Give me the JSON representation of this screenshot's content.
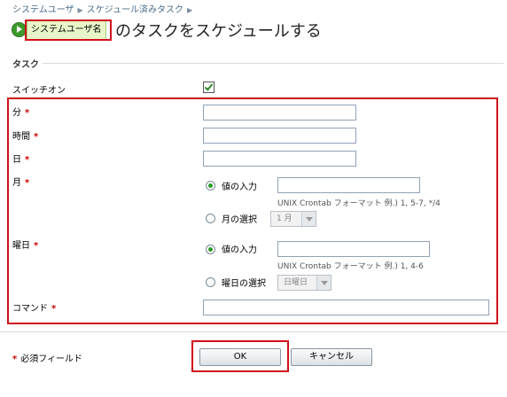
{
  "breadcrumb": [
    "システムユーザ",
    "スケジュール済みタスク"
  ],
  "header": {
    "user_tag": "システムユーザ名",
    "title": "のタスクをスケジュールする"
  },
  "section": {
    "title": "タスク"
  },
  "form": {
    "switch_on": {
      "label": "スイッチオン",
      "checked": true
    },
    "minute": {
      "label": "分",
      "value": ""
    },
    "hour": {
      "label": "時間",
      "value": ""
    },
    "day": {
      "label": "日",
      "value": ""
    },
    "month": {
      "label": "月",
      "option_enter": "値の入力",
      "value": "",
      "hint": "UNIX Crontab フォーマット 例.) 1, 5-7, */4",
      "option_select": "月の選択",
      "select_value": "1 月",
      "selected_option": "enter"
    },
    "weekday": {
      "label": "曜日",
      "option_enter": "値の入力",
      "value": "",
      "hint": "UNIX Crontab フォーマット 例.) 1, 4-6",
      "option_select": "曜日の選択",
      "select_value": "日曜日",
      "selected_option": "enter"
    },
    "command": {
      "label": "コマンド",
      "value": ""
    },
    "required_marker": "*"
  },
  "footer": {
    "required_note": "必須フィールド",
    "ok_label": "OK",
    "cancel_label": "キャンセル"
  },
  "colors": {
    "highlight": "#d0101c",
    "required": "#cc0000",
    "check": "#2a8a2a"
  }
}
